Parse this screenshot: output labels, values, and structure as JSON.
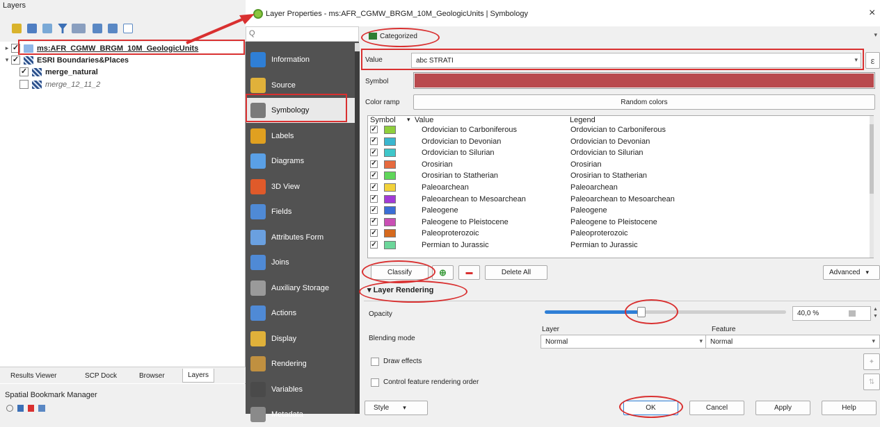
{
  "layers_panel": {
    "title": "Layers",
    "layers": [
      {
        "name": "ms:AFR_CGMW_BRGM_10M_GeologicUnits",
        "checked": true,
        "bold": true,
        "expanded": false,
        "icon": "wms-layer-icon"
      },
      {
        "name": "ESRI Boundaries&Places",
        "checked": true,
        "bold": true,
        "expanded": true,
        "icon": "raster-layer-icon"
      },
      {
        "name": "merge_natural",
        "checked": true,
        "bold": true,
        "icon": "raster-layer-icon"
      },
      {
        "name": "merge_12_11_2",
        "checked": false,
        "bold": false,
        "italic": true,
        "icon": "raster-layer-icon"
      }
    ],
    "bottom_tabs": [
      "Results Viewer",
      "SCP Dock",
      "Browser",
      "Layers"
    ],
    "active_tab": "Layers",
    "bookmark_manager": "Spatial Bookmark Manager"
  },
  "dialog": {
    "title": "Layer Properties - ms:AFR_CGMW_BRGM_10M_GeologicUnits | Symbology",
    "close": "×",
    "search_placeholder": "Q",
    "nav_items": [
      "Information",
      "Source",
      "Symbology",
      "Labels",
      "Diagrams",
      "3D View",
      "Fields",
      "Attributes Form",
      "Joins",
      "Auxiliary Storage",
      "Actions",
      "Display",
      "Rendering",
      "Variables",
      "Metadata"
    ],
    "selected_nav": "Symbology",
    "renderer": "Categorized",
    "value_label": "Value",
    "value_field": "abc STRATI",
    "expression_icon": "ε",
    "symbol_label": "Symbol",
    "symbol_color": "#b94a4e",
    "color_ramp_label": "Color ramp",
    "color_ramp_value": "Random colors",
    "table_headers": {
      "symbol": "Symbol",
      "value": "Value",
      "legend": "Legend"
    },
    "categories": [
      {
        "value": "Ordovician to Carboniferous",
        "legend": "Ordovician to Carboniferous",
        "color": "#8fcf3c"
      },
      {
        "value": "Ordovician to Devonian",
        "legend": "Ordovician to Devonian",
        "color": "#3ab6cf"
      },
      {
        "value": "Ordovician to Silurian",
        "legend": "Ordovician to Silurian",
        "color": "#3fc6c9"
      },
      {
        "value": "Orosirian",
        "legend": "Orosirian",
        "color": "#e66a3e"
      },
      {
        "value": "Orosirian to Statherian",
        "legend": "Orosirian to Statherian",
        "color": "#5fd65a"
      },
      {
        "value": "Paleoarchean",
        "legend": "Paleoarchean",
        "color": "#f2d23a"
      },
      {
        "value": "Paleoarchean to Mesoarchean",
        "legend": "Paleoarchean to Mesoarchean",
        "color": "#a23ad6"
      },
      {
        "value": "Paleogene",
        "legend": "Paleogene",
        "color": "#3a6ed6"
      },
      {
        "value": "Paleogene to Pleistocene",
        "legend": "Paleogene to Pleistocene",
        "color": "#c94fb4"
      },
      {
        "value": "Paleoproterozoic",
        "legend": "Paleoproterozoic",
        "color": "#d66a1e"
      },
      {
        "value": "Permian to Jurassic",
        "legend": "Permian to Jurassic",
        "color": "#6cd69a"
      }
    ],
    "classify": "Classify",
    "delete_all": "Delete All",
    "advanced": "Advanced",
    "layer_rendering": "Layer Rendering",
    "opacity_label": "Opacity",
    "opacity_value": "40,0 %",
    "opacity_fraction": 0.4,
    "blending_label": "Blending mode",
    "layer_col": "Layer",
    "feature_col": "Feature",
    "layer_blend": "Normal",
    "feature_blend": "Normal",
    "draw_effects": "Draw effects",
    "control_order": "Control feature rendering order",
    "style": "Style",
    "ok": "OK",
    "cancel": "Cancel",
    "apply": "Apply",
    "help": "Help"
  }
}
